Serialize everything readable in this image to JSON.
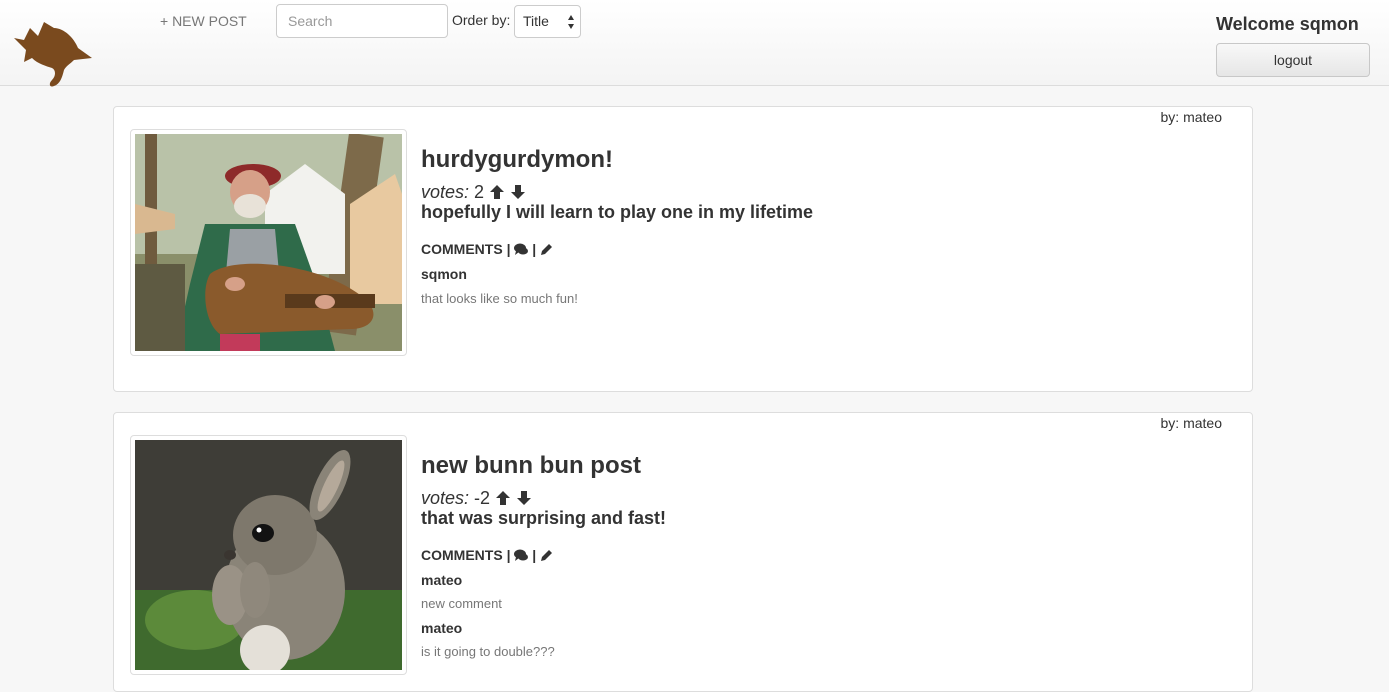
{
  "nav": {
    "new_post_label": "+ NEW POST",
    "search_placeholder": "Search",
    "order_label": "Order by:",
    "order_value": "Title",
    "welcome": "Welcome sqmon",
    "logout_label": "logout",
    "logo_color": "#7a4a1e"
  },
  "posts": [
    {
      "author": "by: mateo",
      "title": "hurdygurdymon!",
      "votes_label": "votes:",
      "votes": "2",
      "body": "hopefully I will learn to play one in my lifetime",
      "comments_label": "COMMENTS",
      "comments": [
        {
          "author": "sqmon",
          "text": "that looks like so much fun!"
        }
      ]
    },
    {
      "author": "by: mateo",
      "title": "new bunn bun post",
      "votes_label": "votes:",
      "votes": "-2",
      "body": "that was surprising and fast!",
      "comments_label": "COMMENTS",
      "comments": [
        {
          "author": "mateo",
          "text": "new comment"
        },
        {
          "author": "mateo",
          "text": "is it going to double???"
        }
      ]
    }
  ]
}
